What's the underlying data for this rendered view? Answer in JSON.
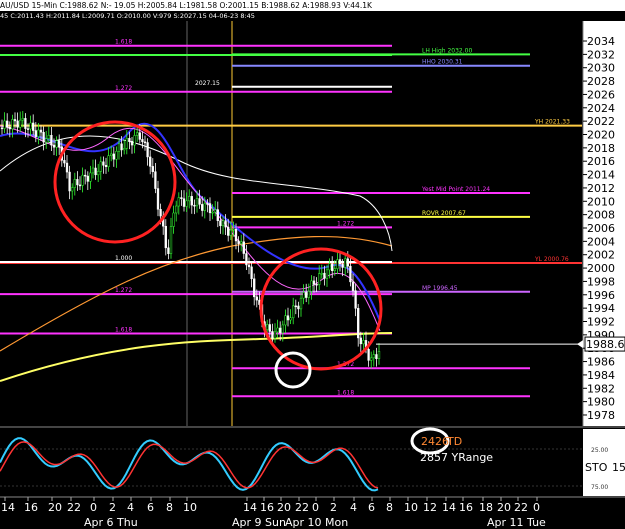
{
  "header": {
    "symbol": "AU/USD",
    "timeframe": "15-Min",
    "close": "C:1988.62",
    "net": "N:- 19.05",
    "high": "H:2005.84",
    "low": "L:1981.58",
    "open": "O:2001.15",
    "bid": "B:1988.62",
    "ask": "A:1988.93",
    "volume": "V:44.1K"
  },
  "subheader": {
    "text": "45  C:2011.43  H:2011.84  L:2009.71  O:2010.00  V:979  S:2027.15  04-06-23  8:45"
  },
  "chart_data": {
    "type": "candlestick",
    "ylim": [
      1976.5,
      2035.5
    ],
    "y_ticks": [
      1978,
      1980,
      1982,
      1984,
      1986,
      1988,
      1990,
      1992,
      1994,
      1996,
      1998,
      2000,
      2002,
      2004,
      2006,
      2008,
      2010,
      2012,
      2014,
      2016,
      2018,
      2020,
      2022,
      2024,
      2026,
      2028,
      2030,
      2032,
      2034
    ],
    "last_price": 1988.62,
    "last_price_label": "1988.62",
    "x_tick_labels": [
      "14",
      "16",
      "20",
      "22",
      "0",
      "2",
      "4",
      "6",
      "8",
      "10",
      "14",
      "16",
      "20",
      "22",
      "0",
      "2",
      "4",
      "6",
      "8",
      "10",
      "12",
      "14",
      "16",
      "18",
      "20",
      "22",
      "0"
    ],
    "day_labels": [
      "Apr 6 Thu",
      "Apr 9 Sun",
      "Apr 10 Mon",
      "Apr 11 Tue"
    ],
    "levels": [
      {
        "label": "1.618",
        "y": 2033.3,
        "color": "#ff33ff",
        "segment": "left"
      },
      {
        "label": "",
        "y": 2031.9,
        "color": "#44ff44",
        "segment": "left"
      },
      {
        "label": "LH High 2032.00",
        "y": 2032.0,
        "color": "#44ff44",
        "segment": "right"
      },
      {
        "label": "HHO 2030.31",
        "y": 2030.3,
        "color": "#8888ff",
        "segment": "right"
      },
      {
        "label": "1.272",
        "y": 2026.4,
        "color": "#ff33ff",
        "segment": "left"
      },
      {
        "label": "2027.15",
        "y": 2027.15,
        "color": "#ffffff",
        "segment": "label"
      },
      {
        "label": "YH 2021.33",
        "y": 2021.33,
        "color": "#ffcc44",
        "segment": "full"
      },
      {
        "label": "Yest Mid Point 2011.24",
        "y": 2011.24,
        "color": "#ff33ff",
        "segment": "right"
      },
      {
        "label": "ROVR 2007.67",
        "y": 2007.67,
        "color": "#ffff44",
        "segment": "right"
      },
      {
        "label": "1.272",
        "y": 2006.1,
        "color": "#ff33ff",
        "segment": "mid"
      },
      {
        "label": "YL 2000.76",
        "y": 2000.76,
        "color": "#ff3333",
        "segment": "full"
      },
      {
        "label": "1.000",
        "y": 2000.9,
        "color": "#ffffff",
        "segment": "left"
      },
      {
        "label": "MP 1996.45",
        "y": 1996.45,
        "color": "#cc66ff",
        "segment": "right"
      },
      {
        "label": "1.272",
        "y": 1996.1,
        "color": "#ff33ff",
        "segment": "left"
      },
      {
        "label": "1.618",
        "y": 1990.2,
        "color": "#ff33ff",
        "segment": "left"
      },
      {
        "label": "1.272",
        "y": 1985.0,
        "color": "#ff33ff",
        "segment": "right"
      },
      {
        "label": "1.618",
        "y": 1980.8,
        "color": "#ff33ff",
        "segment": "right"
      }
    ],
    "stochastic": {
      "label": "STO",
      "period": "15",
      "levels": [
        "25.00",
        "75.00"
      ]
    },
    "annotations": {
      "td_value": "2426",
      "td_label": "TD",
      "yrange": "2857 YRange"
    }
  }
}
